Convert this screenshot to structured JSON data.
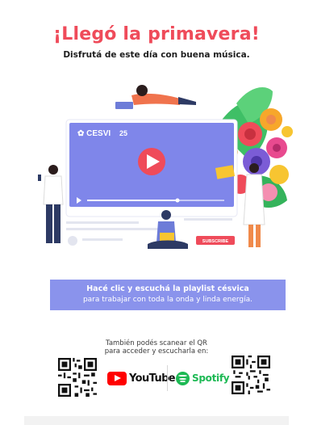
{
  "header": {
    "title": "¡Llegó la primavera!",
    "subtitle": "Disfrutá de este día con buena música."
  },
  "illustration": {
    "brand_logo": "CESVI 25 AÑOS",
    "subscribe_label": "SUBSCRIBE",
    "colors": {
      "video_bg": "#7f86ea",
      "play_button": "#ef4b5a",
      "accent": "#f08a4b"
    }
  },
  "banner": {
    "line1": "Hacé clic y escuchá la playlist césvica",
    "line2": "para trabajar con toda la onda y linda energía.",
    "color": "#8a93ec"
  },
  "qr_section": {
    "note_line1": "También podés scanear el QR",
    "note_line2": "para acceder y escucharla en:"
  },
  "services": {
    "youtube_label": "YouTube",
    "spotify_label": "Spotify"
  }
}
